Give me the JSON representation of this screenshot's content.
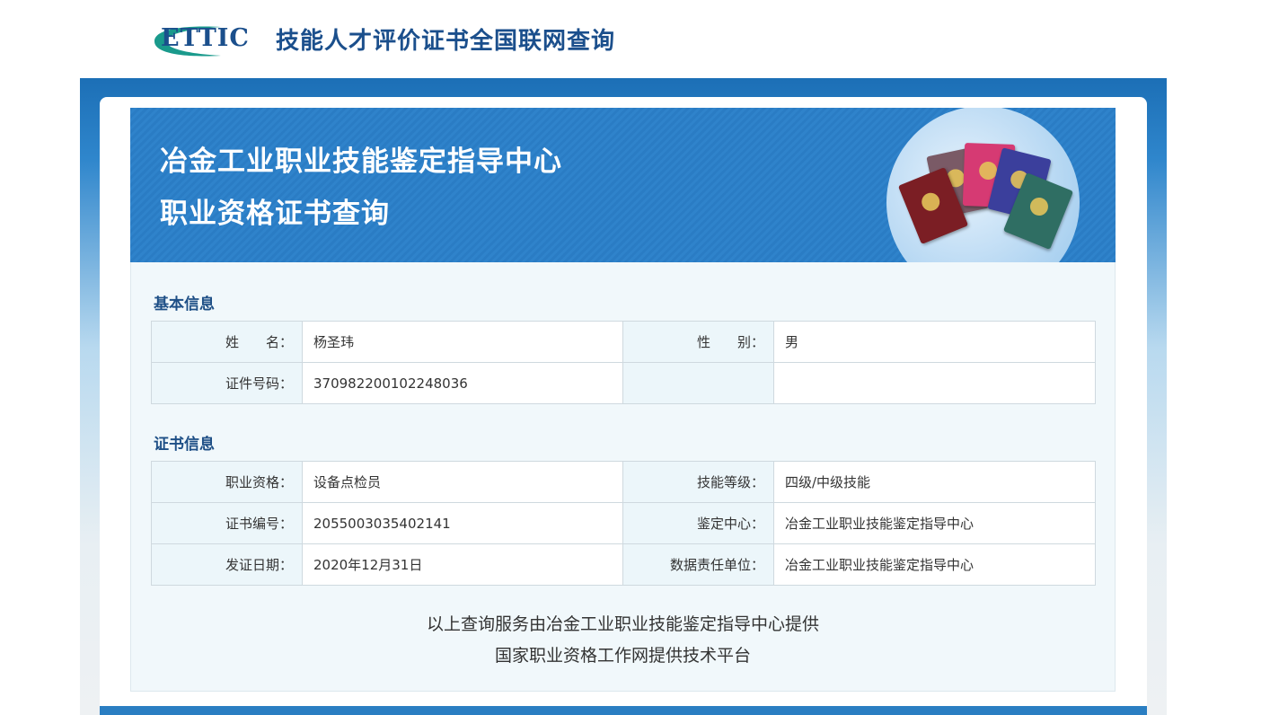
{
  "header": {
    "logo_text": "ETTIC",
    "site_title": "技能人才评价证书全国联网查询"
  },
  "hero": {
    "title_line1": "冶金工业职业技能鉴定指导中心",
    "title_line2": "职业资格证书查询"
  },
  "basic_info": {
    "section_title": "基本信息",
    "name_label": "姓　　名：",
    "name_value": "杨圣玮",
    "gender_label": "性　　别：",
    "gender_value": "男",
    "id_label": "证件号码：",
    "id_value": "370982200102248036"
  },
  "cert_info": {
    "section_title": "证书信息",
    "occupation_label": "职业资格：",
    "occupation_value": "设备点检员",
    "level_label": "技能等级：",
    "level_value": "四级/中级技能",
    "cert_no_label": "证书编号：",
    "cert_no_value": "2055003035402141",
    "center_label": "鉴定中心：",
    "center_value": "冶金工业职业技能鉴定指导中心",
    "date_label": "发证日期：",
    "date_value": "2020年12月31日",
    "unit_label": "数据责任单位：",
    "unit_value": "冶金工业职业技能鉴定指导中心"
  },
  "footer": {
    "line1": "以上查询服务由冶金工业职业技能鉴定指导中心提供",
    "line2": "国家职业资格工作网提供技术平台"
  },
  "colors": {
    "brand_blue": "#1b4f8c",
    "hero_blue": "#2f83cb",
    "teal": "#1a9a8c"
  }
}
